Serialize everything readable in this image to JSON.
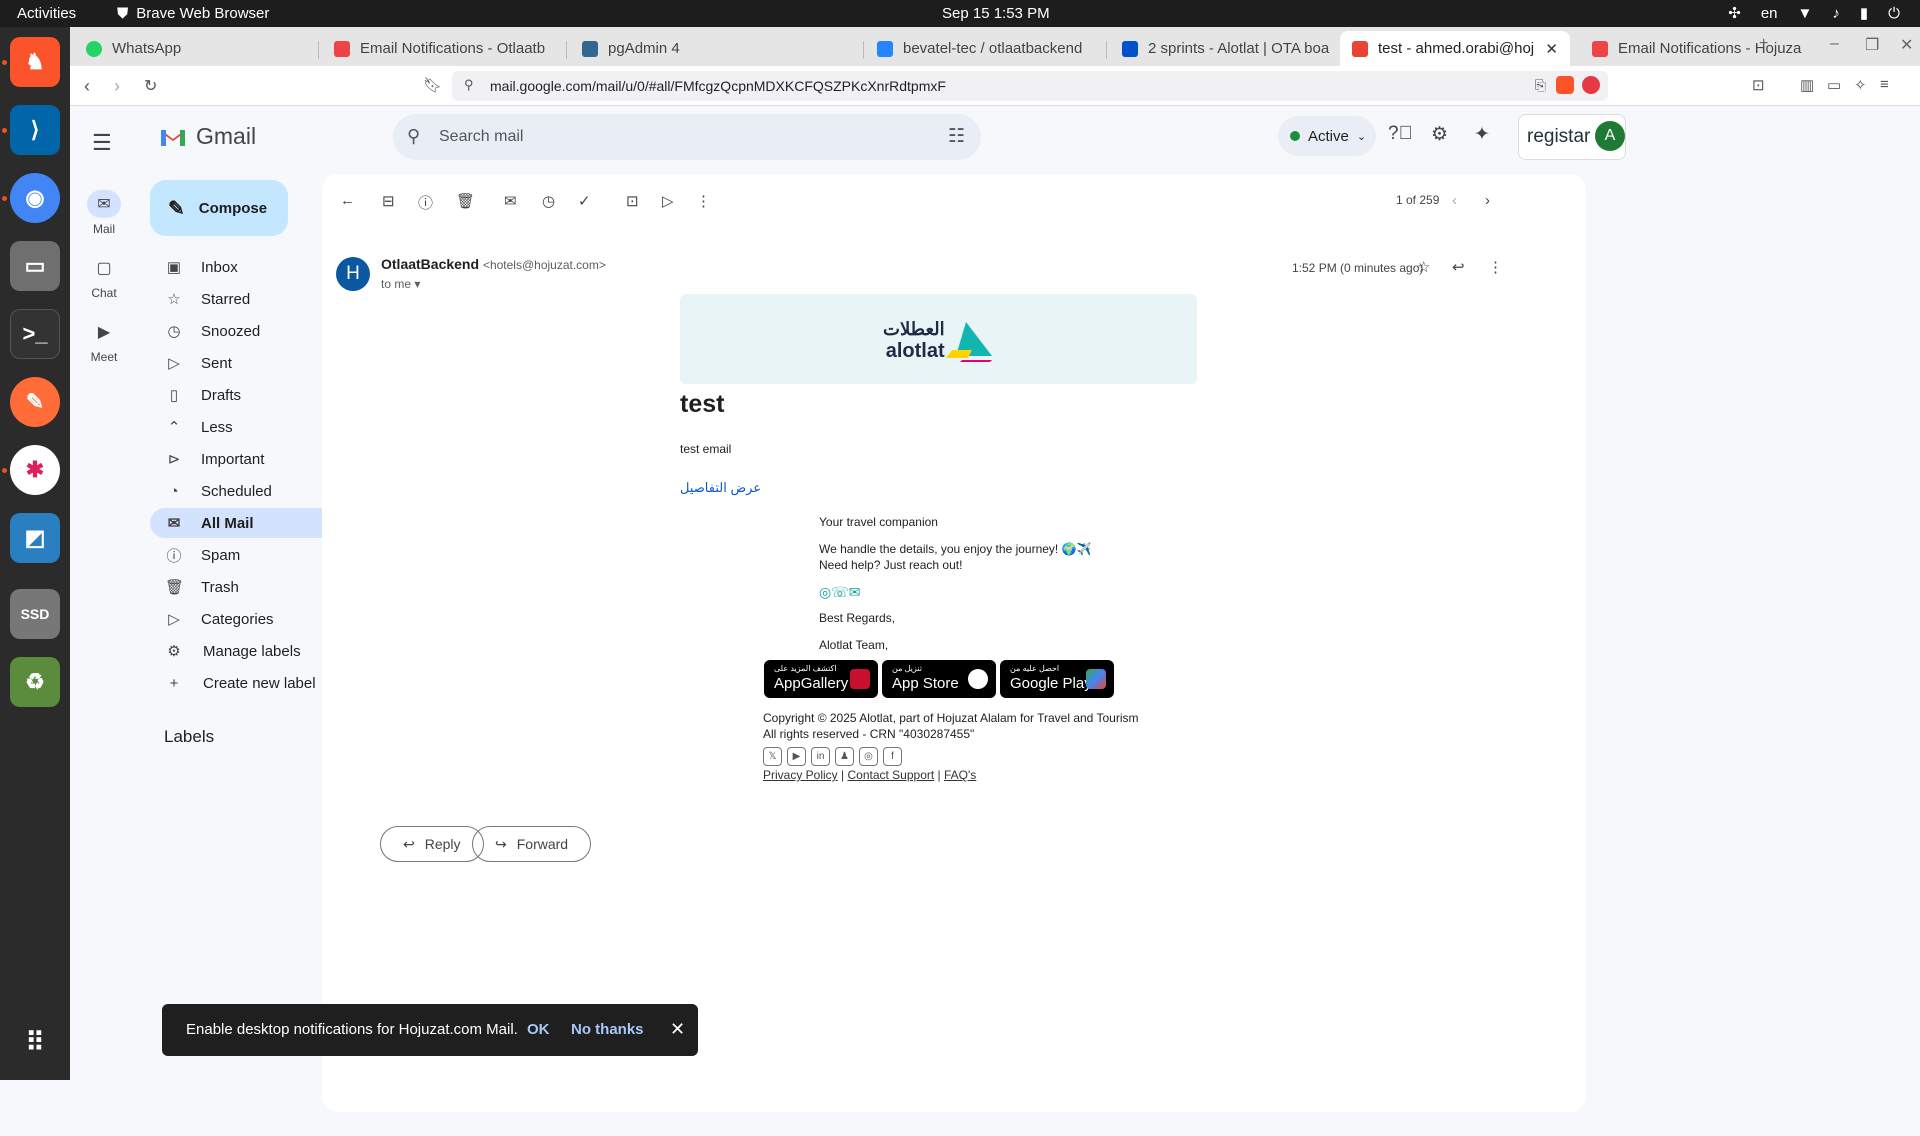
{
  "os": {
    "activities": "Activities",
    "app_name": "Brave Web Browser",
    "clock": "Sep 15  1:53 PM",
    "lang": "en"
  },
  "browser": {
    "tabs": [
      {
        "label": "WhatsApp",
        "color": "#25d366"
      },
      {
        "label": "Email Notifications - Otlaatb",
        "color": "#e44"
      },
      {
        "label": "pgAdmin 4",
        "color": "#336791"
      },
      {
        "label": "bevatel-tec / otlaatbackend",
        "color": "#2684ff"
      },
      {
        "label": "2 sprints - Alotlat | OTA boa",
        "color": "#0052cc"
      },
      {
        "label": "test - ahmed.orabi@hoju",
        "color": "#ea4335"
      },
      {
        "label": "Email Notifications - Hojuza",
        "color": "#e44"
      }
    ],
    "url": "mail.google.com/mail/u/0/#all/FMfcgzQcpnMDXKCFQSZPKcXnrRdtpmxF"
  },
  "gmail": {
    "logo": "Gmail",
    "rail": [
      {
        "label": "Mail",
        "icon": "mail-icon"
      },
      {
        "label": "Chat",
        "icon": "chat-icon"
      },
      {
        "label": "Meet",
        "icon": "meet-icon"
      }
    ],
    "compose": "Compose",
    "nav": [
      {
        "label": "Inbox",
        "icon": "inbox-icon"
      },
      {
        "label": "Starred",
        "icon": "star-icon"
      },
      {
        "label": "Snoozed",
        "icon": "clock-icon"
      },
      {
        "label": "Sent",
        "icon": "send-icon"
      },
      {
        "label": "Drafts",
        "icon": "draft-icon"
      },
      {
        "label": "Less",
        "icon": "chevron-up-icon"
      },
      {
        "label": "Important",
        "icon": "important-icon"
      },
      {
        "label": "Scheduled",
        "icon": "scheduled-icon"
      },
      {
        "label": "All Mail",
        "icon": "all-mail-icon"
      },
      {
        "label": "Spam",
        "icon": "spam-icon"
      },
      {
        "label": "Trash",
        "icon": "trash-icon"
      },
      {
        "label": "Categories",
        "icon": "label-icon"
      },
      {
        "label": "Manage labels",
        "icon": "gear-icon"
      },
      {
        "label": "Create new label",
        "icon": "plus-icon"
      }
    ],
    "labels_header": "Labels",
    "search_placeholder": "Search mail",
    "status": "Active",
    "pager": "1 of 259",
    "registar": "registar"
  },
  "email": {
    "sender_name": "OtlaatBackend",
    "sender_email": "<hotels@hojuzat.com>",
    "to": "to me",
    "avatar_letter": "H",
    "time": "1:52 PM (0 minutes ago)",
    "brand_ar": "العطلات",
    "brand_en": "alotlat",
    "subject": "test",
    "body": "test email",
    "details_link": "عرض التفاصيل",
    "companion": "Your travel companion",
    "line1": "We handle the details, you enjoy the journey! 🌍✈️",
    "line2": "Need help? Just reach out!",
    "regards": "Best Regards,",
    "team": "Alotlat Team,",
    "stores": [
      {
        "small": "اكتشف المزيد على",
        "big": "AppGallery",
        "color": "#c8102e"
      },
      {
        "small": "تنزيل من",
        "big": "App Store",
        "color": "#ffffff"
      },
      {
        "small": "احصل عليه من",
        "big": "Google Play",
        "color": "#34a853"
      }
    ],
    "copyright": "Copyright © 2025 Alotlat, part of Hojuzat Alalam for Travel and Tourism",
    "rights": "All rights reserved - CRN \"4030287455\"",
    "links": [
      "Privacy Policy",
      "Contact Support",
      "FAQ's"
    ],
    "reply": "Reply",
    "forward": "Forward"
  },
  "toast": {
    "message": "Enable desktop notifications for Hojuzat.com Mail.",
    "ok": "OK",
    "no": "No thanks"
  }
}
